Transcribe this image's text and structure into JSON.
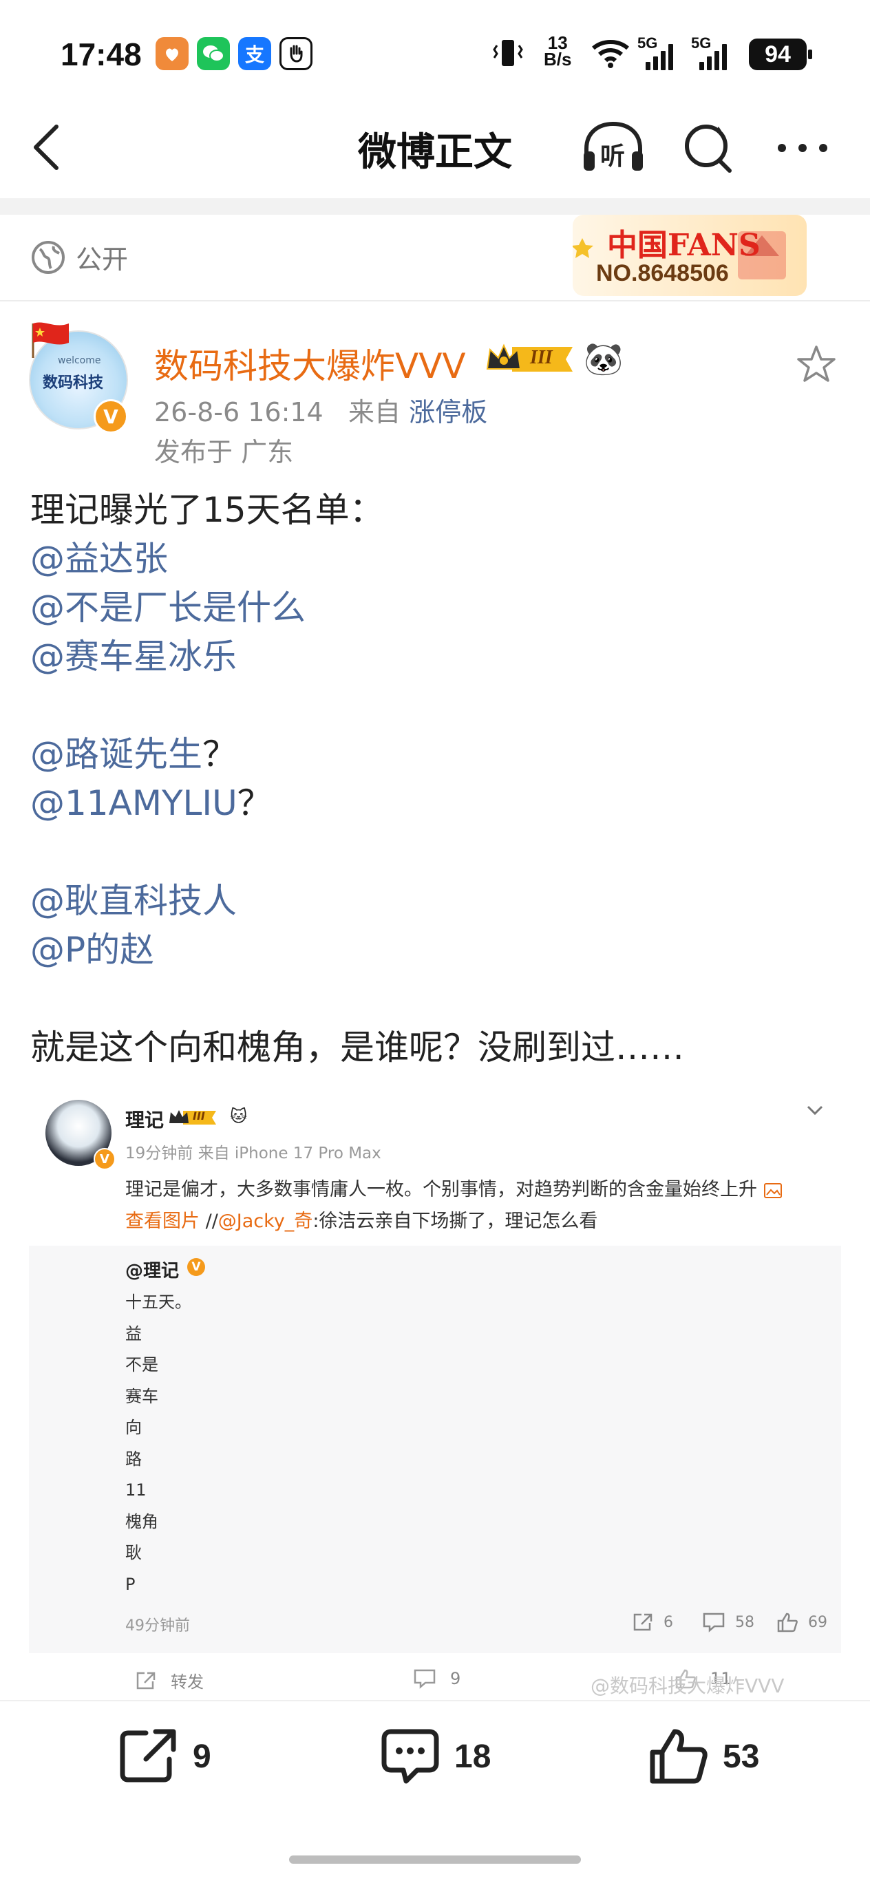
{
  "status_bar": {
    "time": "17:48",
    "net_speed_top": "13",
    "net_speed_bottom": "B/s",
    "signal_label_1": "5G",
    "signal_label_2": "5G",
    "battery": "94",
    "alipay_icon_glyph": "支"
  },
  "nav": {
    "title": "微博正文",
    "listen_label": "听"
  },
  "visibility": {
    "label": "公开"
  },
  "fans_badge": {
    "title": "中国FANS",
    "number": "NO.8648506"
  },
  "post": {
    "avatar_text": "数码科技",
    "avatar_welcome": "welcome",
    "verified_glyph": "V",
    "author": "数码科技大爆炸VVV",
    "level_badge": "III",
    "emoji_badge": "🐼",
    "date": "26-8-6 16:14",
    "from_label": "来自",
    "source": "涨停板",
    "location": "发布于 广东",
    "lines": [
      {
        "text": "理记曝光了15天名单：",
        "mention": false,
        "suffix": ""
      },
      {
        "text": "@益达张",
        "mention": true,
        "suffix": ""
      },
      {
        "text": "@不是厂长是什么",
        "mention": true,
        "suffix": ""
      },
      {
        "text": "@赛车星冰乐",
        "mention": true,
        "suffix": ""
      },
      {
        "text": "",
        "mention": false,
        "suffix": ""
      },
      {
        "text": "@路诞先生",
        "mention": true,
        "suffix": "？"
      },
      {
        "text": "@11AMYLIU",
        "mention": true,
        "suffix": "？"
      },
      {
        "text": "",
        "mention": false,
        "suffix": ""
      },
      {
        "text": "@耿直科技人",
        "mention": true,
        "suffix": ""
      },
      {
        "text": "@P的赵",
        "mention": true,
        "suffix": ""
      },
      {
        "text": "",
        "mention": false,
        "suffix": ""
      },
      {
        "text": "就是这个向和槐角，是谁呢？没刷到过……",
        "mention": false,
        "suffix": ""
      }
    ]
  },
  "embedded": {
    "name": "理记",
    "level_badge": "III",
    "emoji_badge": "🐱",
    "meta": "19分钟前 来自 iPhone 17 Pro Max",
    "text_line1": "理记是偏才，大多数事情庸人一枚。个别事情，对趋势判断的含金量始终上升",
    "view_image": "查看图片",
    "repost_sep": "//",
    "repost_user": "@Jacky_奇",
    "repost_text": ":徐洁云亲自下场撕了，理记怎么看",
    "quote_name": "@理记",
    "quote_lines": [
      "十五天。",
      "益",
      "不是",
      "赛车",
      "向",
      "路",
      "11",
      "槐角",
      "耿",
      "P"
    ],
    "quote_time": "49分钟前",
    "quote_reposts": "6",
    "quote_comments": "58",
    "quote_likes": "69",
    "action_repost": "转发",
    "action_comments": "9",
    "action_likes": "11",
    "watermark": "@数码科技大爆炸VVV"
  },
  "bottom_bar": {
    "reposts": "9",
    "comments": "18",
    "likes": "53"
  }
}
